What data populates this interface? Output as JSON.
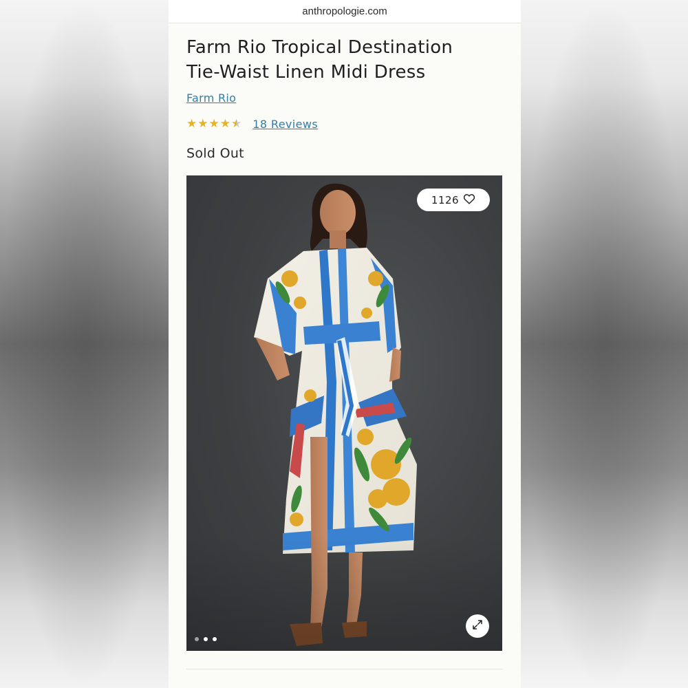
{
  "browser": {
    "url": "anthropologie.com"
  },
  "product": {
    "title_line1": "Farm Rio Tropical Destination",
    "title_line2": "Tie-Waist Linen Midi Dress",
    "brand": "Farm Rio",
    "rating": 4.5,
    "rating_max": 5,
    "reviews_label": "18 Reviews",
    "status": "Sold Out"
  },
  "gallery": {
    "like_count": "1126",
    "total_images": 3,
    "active_index": 0
  },
  "colors": {
    "link": "#2f7fa6",
    "star": "#e6b325",
    "page_bg": "#fbfbf8"
  },
  "icons": {
    "like": "heart-outline-icon",
    "expand": "expand-arrows-icon"
  }
}
